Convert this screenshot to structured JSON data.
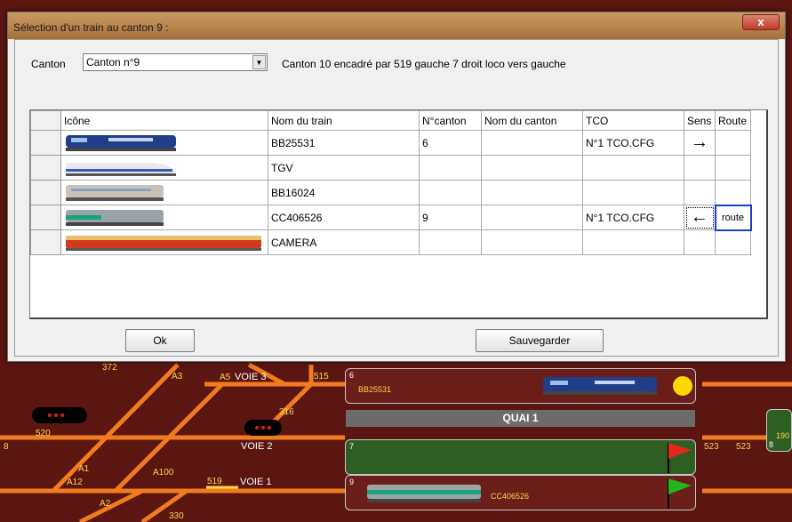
{
  "dialog": {
    "title": "Sélection d'un train au canton 9 :",
    "close_label": "x",
    "canton_label": "Canton",
    "canton_selected": "Canton n°9",
    "canton_info": "Canton 10 encadré par 519 gauche  7 droit  loco vers  gauche",
    "columns": [
      "Icône",
      "Nom du train",
      "N°canton",
      "Nom du canton",
      "TCO",
      "Sens",
      "Route"
    ],
    "rows": [
      {
        "icon": "bb25531-loco-icon",
        "name": "BB25531",
        "canton": "6",
        "canton_name": "",
        "tco": "N°1 TCO.CFG",
        "sens": "→",
        "route": ""
      },
      {
        "icon": "tgv-loco-icon",
        "name": "TGV",
        "canton": "",
        "canton_name": "",
        "tco": "",
        "sens": "",
        "route": ""
      },
      {
        "icon": "bb16024-loco-icon",
        "name": "BB16024",
        "canton": "",
        "canton_name": "",
        "tco": "",
        "sens": "",
        "route": ""
      },
      {
        "icon": "cc406526-loco-icon",
        "name": "CC406526",
        "canton": "9",
        "canton_name": "",
        "tco": "N°1 TCO.CFG",
        "sens": "←",
        "route": "route"
      },
      {
        "icon": "camera-train-icon",
        "name": "CAMERA",
        "canton": "",
        "canton_name": "",
        "tco": "",
        "sens": "",
        "route": ""
      }
    ],
    "ok_label": "Ok",
    "save_label": "Sauvegarder"
  },
  "track": {
    "labels": {
      "a3": "A3",
      "a5": "A5",
      "voie3": "VOIE 3",
      "n515": "515",
      "n6": "6",
      "bb25531": "BB25531",
      "n316": "316",
      "n520": "520",
      "quai1": "QUAI 1",
      "voie2": "VOIE 2",
      "n7": "7",
      "n523a": "523",
      "n523b": "523",
      "n190": "190",
      "n8": "8",
      "n8left": "8",
      "a1": "A1",
      "a100": "A100",
      "a12": "A12",
      "n519": "519",
      "voie1": "VOIE 1",
      "n9": "9",
      "cc406526": "CC406526",
      "a2": "A2",
      "n330": "330",
      "n372": "372"
    }
  },
  "colors": {
    "track": "#f07c1e",
    "block_red": "#6b1e1a",
    "block_green": "#2f5e23",
    "route_border": "#1e3fc4"
  }
}
